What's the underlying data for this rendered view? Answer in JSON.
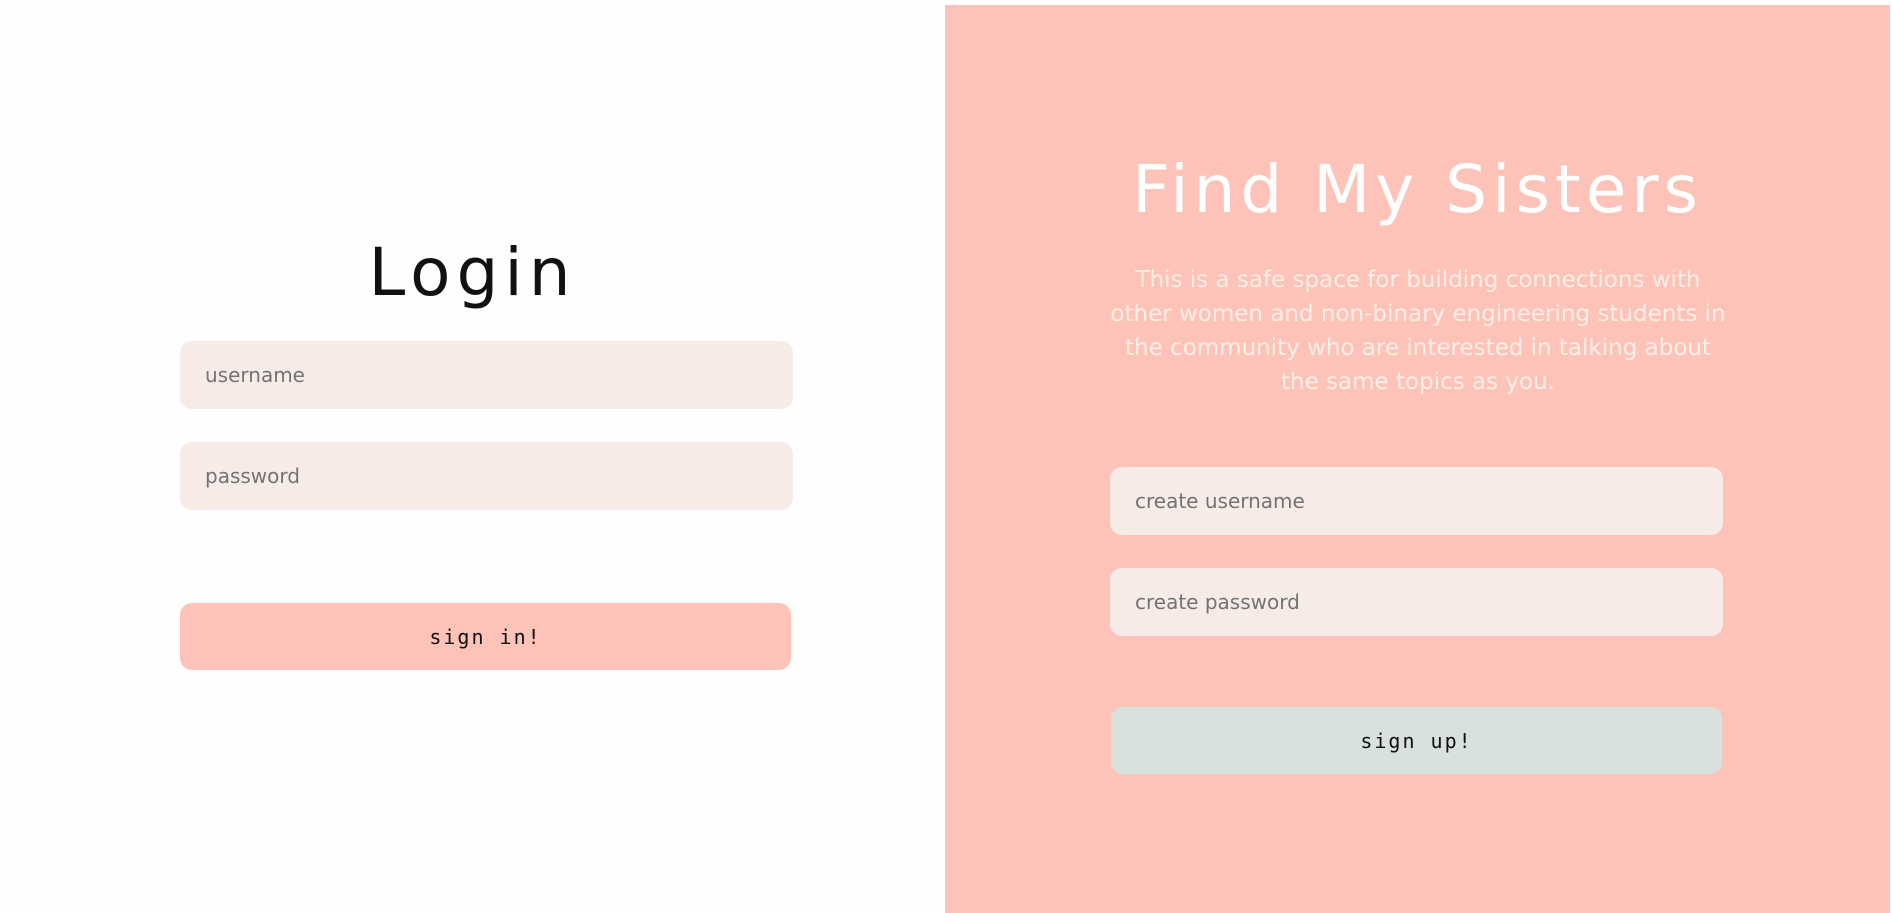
{
  "login": {
    "title": "Login",
    "username_placeholder": "username",
    "password_placeholder": "password",
    "sign_in_label": "sign in!"
  },
  "signup": {
    "brand_title": "Find My Sisters",
    "tagline": "This is a safe space for building connections with other women and non-binary engineering students in the community who are interested in talking about the same topics as you.",
    "username_placeholder": "create username",
    "password_placeholder": "create password",
    "sign_up_label": "sign up!"
  },
  "colors": {
    "accent_pink": "#fdc3b8",
    "field_bg": "#f7ebe8",
    "signup_button": "#d8e1dd",
    "text_dark": "#111111",
    "text_light": "#ffffff"
  }
}
